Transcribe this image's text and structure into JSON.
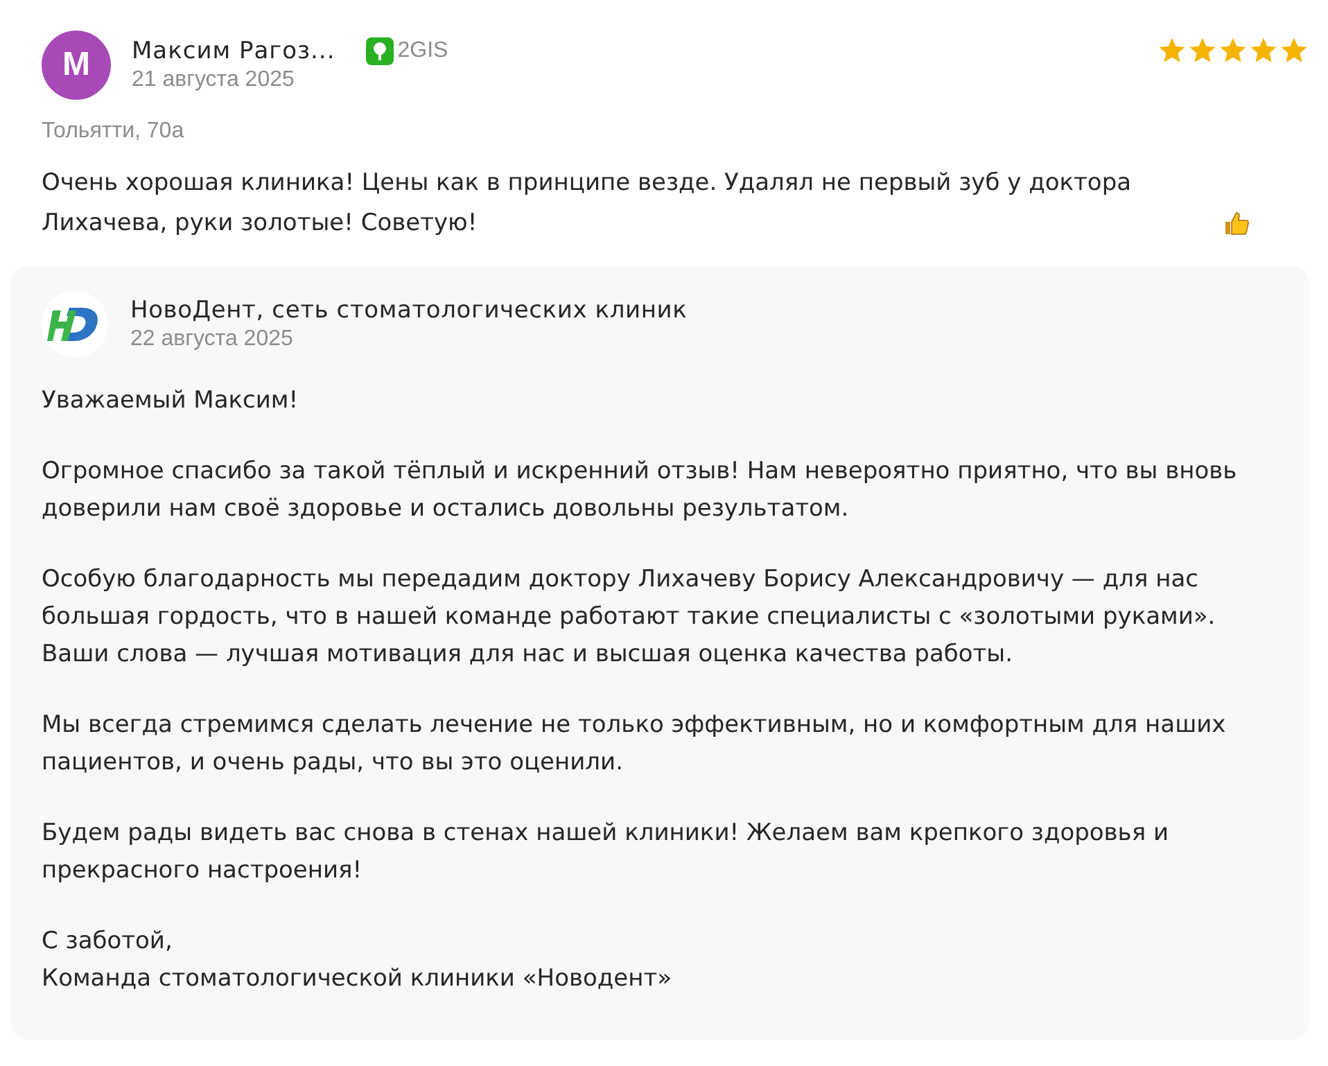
{
  "review": {
    "avatar_letter": "М",
    "author": "Максим Рагоз...",
    "source": "2GIS",
    "date": "21 августа 2025",
    "stars": 5,
    "location": "Тольятти, 70а",
    "text": "Очень хорошая клиника! Цены как в принципе везде. Удалял не первый зуб у доктора Лихачева, руки золотые! Советую!"
  },
  "reply": {
    "author": "НовоДент, сеть стоматологических клиник",
    "date": "22 августа 2025",
    "paragraphs": [
      "Уважаемый Максим!",
      "Огромное спасибо за такой тёплый и искренний отзыв! Нам невероятно приятно, что вы вновь доверили нам своё здоровье и остались довольны результатом.",
      "Особую благодарность мы передадим доктору Лихачеву Борису Александровичу — для нас большая гордость, что в нашей команде работают такие специалисты с «золотыми руками». Ваши слова — лучшая мотивация для нас и высшая оценка качества работы.",
      "Мы всегда стремимся сделать лечение не только эффективным, но и комфортным для наших пациентов, и очень рады, что вы это оценили.",
      "Будем рады видеть вас снова в стенах нашей клиники! Желаем вам крепкого здоровья и прекрасного настроения!"
    ],
    "signature": [
      "С заботой,",
      "Команда стоматологической клиники «Новодент»"
    ]
  }
}
